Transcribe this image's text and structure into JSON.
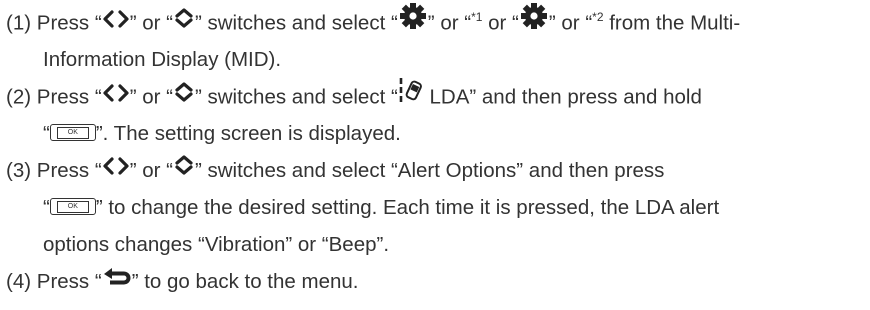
{
  "steps": [
    {
      "num": "(1)",
      "press": "Press “",
      "sep1": "” or “",
      "mid1": "” switches and select “",
      "sup1": "*1",
      "sep2": " or “",
      "sup2": "*2",
      "tail1": " from the Multi-",
      "line2": "Information Display (MID)."
    },
    {
      "num": "(2)",
      "press": "Press “",
      "sep1": "” or “",
      "mid1": "” switches and select “",
      "lda": " LDA” and then press and hold",
      "open2": "“",
      "line2": "”. The setting screen is displayed."
    },
    {
      "num": "(3)",
      "press": "Press “",
      "sep1": "” or “",
      "mid1": "” switches and select “Alert Options” and then press",
      "open2": "“",
      "line2": "” to change the desired setting. Each time it is pressed, the LDA alert",
      "line3": "options changes “Vibration” or “Beep”."
    },
    {
      "num": "(4)",
      "press": "Press “",
      "tail": "” to go back to the menu."
    }
  ],
  "icons": {
    "left_right": "left-right-arrows-icon",
    "up_down": "up-down-arrows-icon",
    "gear1": "gear-icon",
    "gear2": "gear-icon",
    "lda": "lda-icon",
    "ok": "ok-button-icon",
    "back": "back-arrow-icon"
  },
  "ok_label": "OK",
  "colors": {
    "text": "#333333",
    "icon": "#222222"
  }
}
